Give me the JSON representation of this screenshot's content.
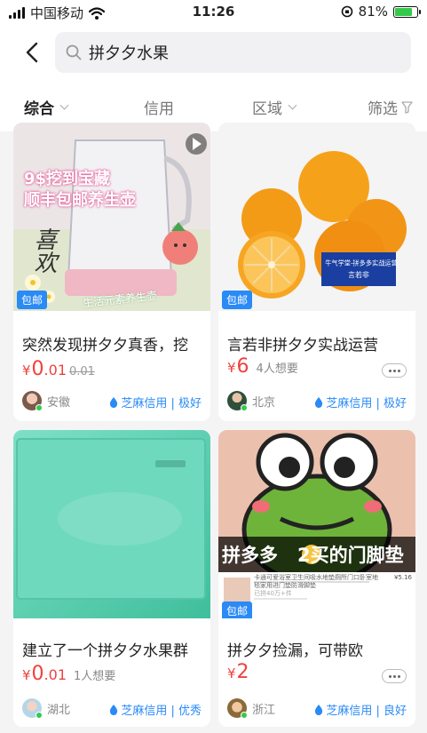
{
  "status_bar": {
    "carrier": "中国移动",
    "time": "11:26",
    "battery": "81%",
    "battery_level": 0.81
  },
  "search": {
    "query": "拼夕夕水果"
  },
  "filters": [
    {
      "label": "综合",
      "active": true,
      "dropdown": true
    },
    {
      "label": "信用",
      "active": false,
      "dropdown": false
    },
    {
      "label": "区域",
      "active": false,
      "dropdown": true
    },
    {
      "label": "筛选",
      "active": false,
      "filter_icon": true
    }
  ],
  "products": [
    {
      "image": {
        "lines": [
          "9$挖到宝藏",
          "顺丰包邮养生壶"
        ],
        "script_text": "喜欢",
        "caption": "生活元素养生壶"
      },
      "badge": "包邮",
      "title": "突然发现拼夕夕真香，挖",
      "currency": "¥",
      "price_int": "0",
      "price_dec": ".01",
      "price_orig": "0.01",
      "want": "",
      "location": "安徽",
      "credit": "芝麻信用 | 极好"
    },
    {
      "image": {
        "sign_line1": "牛气学堂-拼多多实战运营",
        "sign_line2": "言若非"
      },
      "badge": "包邮",
      "title": "言若非拼夕夕实战运营",
      "currency": "¥",
      "price_int": "6",
      "price_dec": "",
      "price_orig": "",
      "want": "4人想要",
      "location": "北京",
      "credit": "芝麻信用 | 极好"
    },
    {
      "image": {},
      "badge": "",
      "title": "建立了一个拼夕夕水果群",
      "currency": "¥",
      "price_int": "0",
      "price_dec": ".01",
      "price_orig": "",
      "want": "1人想要",
      "location": "湖北",
      "credit": "芝麻信用 | 优秀"
    },
    {
      "image": {
        "banner_left": "拼多多",
        "banner_right": "2买的门脚垫",
        "listing_title": "卡通可爱浴室卫生间吸水地垫厕所门口卧室地毯家用进门垫防滑脚垫",
        "listing_price": "¥5.16",
        "listing_sub": "已拼40万+件"
      },
      "badge": "包邮",
      "title": "拼夕夕捡漏，可带欧",
      "currency": "¥",
      "price_int": "2",
      "price_dec": "",
      "price_orig": "",
      "want": "",
      "location": "浙江",
      "credit": "芝麻信用 | 良好"
    }
  ]
}
